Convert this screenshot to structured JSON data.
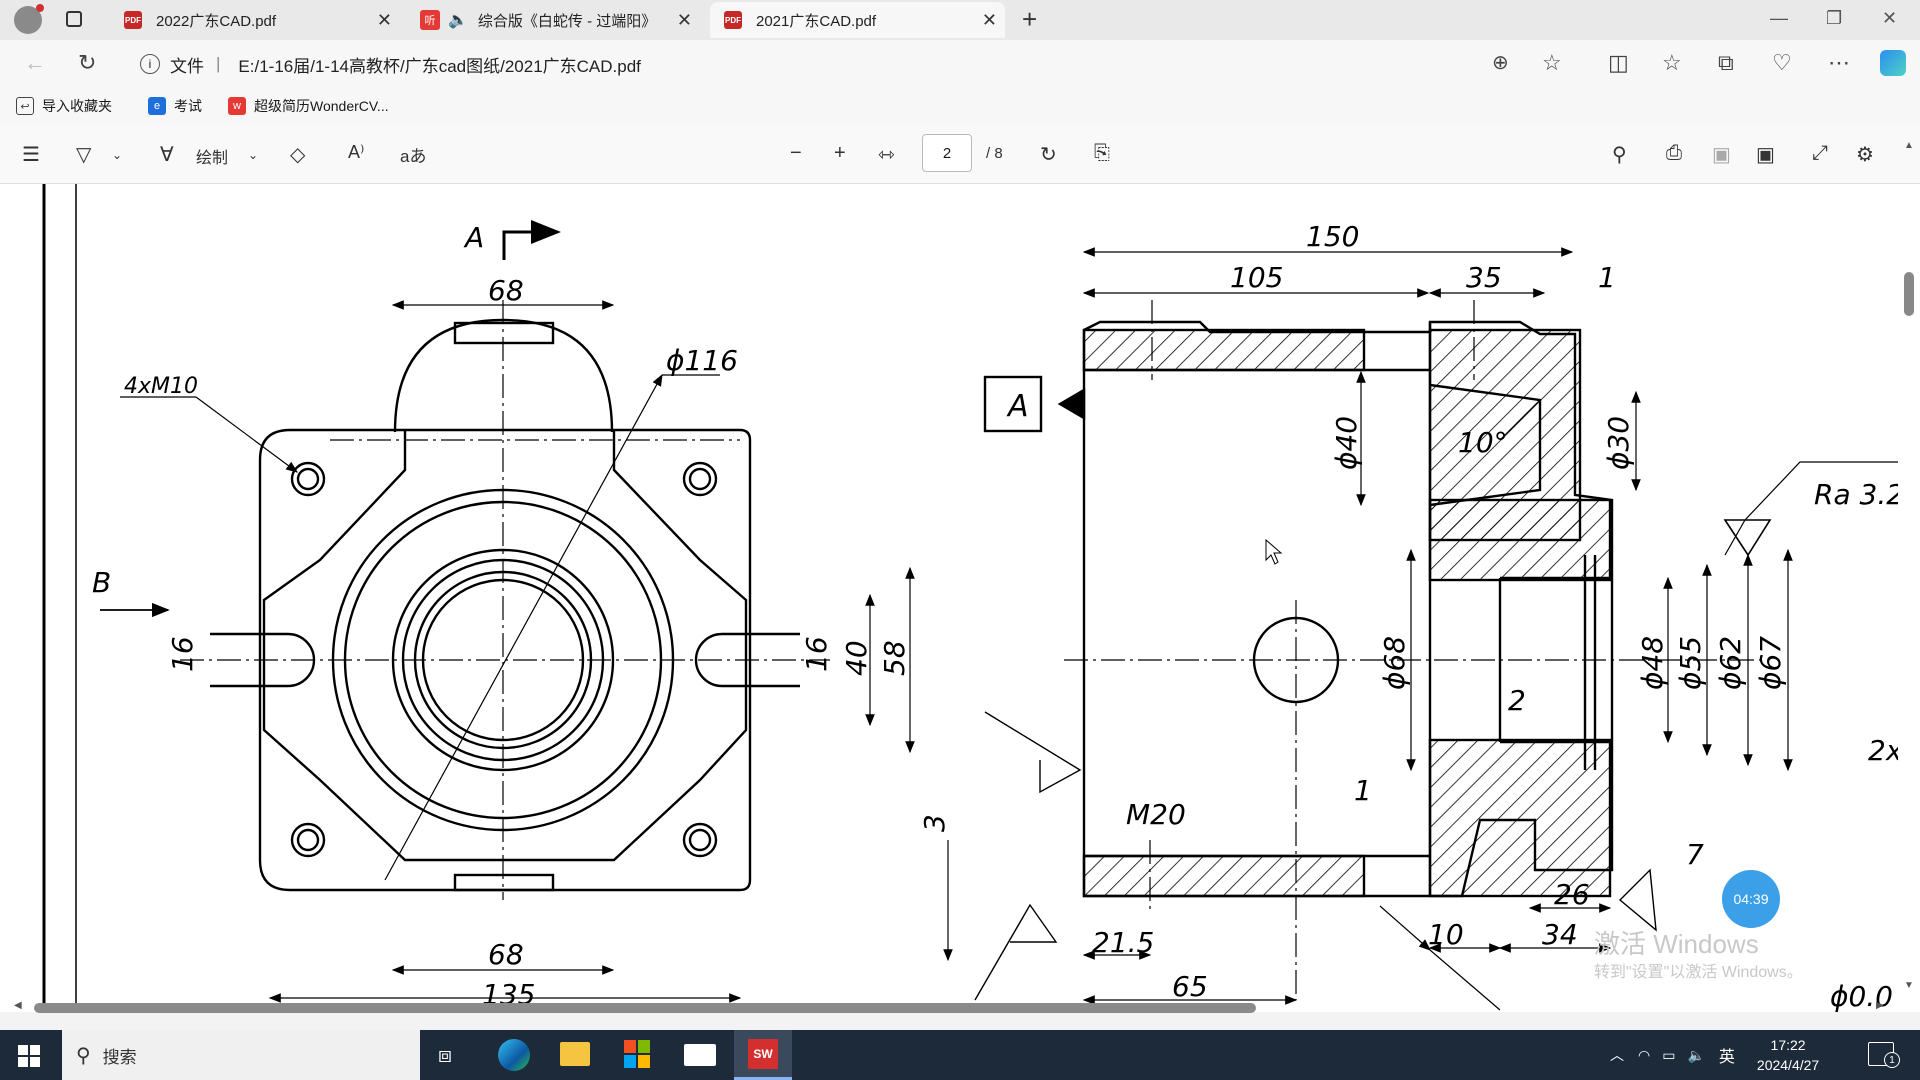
{
  "tabs": [
    {
      "title": "2022广东CAD.pdf",
      "active": false
    },
    {
      "title": "综合版《白蛇传 - 过端阳》",
      "active": false
    },
    {
      "title": "2021广东CAD.pdf",
      "active": true
    }
  ],
  "address": {
    "label": "文件",
    "url": "E:/1-16届/1-14高教杯/广东cad图纸/2021广东CAD.pdf"
  },
  "favorites": [
    {
      "label": "导入收藏夹",
      "icon": "import-icon"
    },
    {
      "label": "考试",
      "icon": "edge-icon"
    },
    {
      "label": "超级简历WonderCV...",
      "icon": "wondercv-icon"
    }
  ],
  "pdf_toolbar": {
    "draw_label": "绘制",
    "page_current": "2",
    "page_total": "/ 8"
  },
  "drawing": {
    "left_view": {
      "view_label": "A",
      "section_label": "B",
      "dims": {
        "top_68": "68",
        "dia_116": "ϕ116",
        "holes": "4xM10",
        "d16_left": "16",
        "d16_right": "16",
        "d40": "40",
        "d58": "58",
        "bottom_68": "68",
        "bottom_135": "135"
      }
    },
    "right_view": {
      "datum": "A",
      "dims": {
        "d150": "150",
        "d105": "105",
        "d35": "35",
        "d1_top": "1",
        "dia40": "ϕ40",
        "angle10": "10°",
        "dia30": "ϕ30",
        "ra": "Ra 3.2",
        "dia68": "ϕ68",
        "dia48": "ϕ48",
        "dia55": "ϕ55",
        "dia62": "ϕ62",
        "dia67": "ϕ67",
        "d2": "2",
        "chamfer": "2x",
        "d1_mid": "1",
        "m20": "M20",
        "d3": "3",
        "d7": "7",
        "d26": "26",
        "d21_5": "21.5",
        "d10": "10",
        "d34": "34",
        "d65": "65",
        "tol": "ϕ0.0"
      }
    }
  },
  "overlay": {
    "timer": "04:39",
    "activation_title": "激活 Windows",
    "activation_sub": "转到\"设置\"以激活 Windows。"
  },
  "taskbar": {
    "search_placeholder": "搜索",
    "ime": "英",
    "time": "17:22",
    "date": "2024/4/27",
    "notifications": "1"
  }
}
